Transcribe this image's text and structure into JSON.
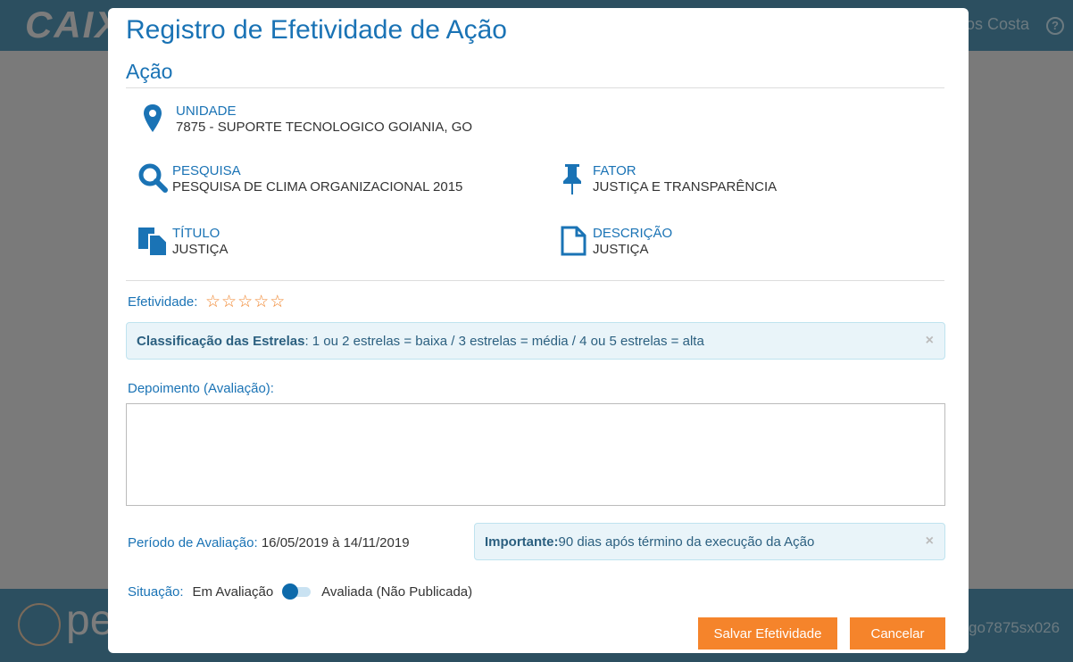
{
  "header": {
    "logo": "CAIXA",
    "user": "os Costa",
    "help": "?"
  },
  "footer": {
    "logo_text": "pe",
    "host": "go7875sx026"
  },
  "modal": {
    "title": "Registro de Efetividade de Ação",
    "section": "Ação",
    "fields": {
      "unidade": {
        "label": "UNIDADE",
        "value": "7875 - SUPORTE TECNOLOGICO GOIANIA, GO"
      },
      "pesquisa": {
        "label": "PESQUISA",
        "value": "PESQUISA DE CLIMA ORGANIZACIONAL 2015"
      },
      "fator": {
        "label": "FATOR",
        "value": "JUSTIÇA E TRANSPARÊNCIA"
      },
      "titulo": {
        "label": "TÍTULO",
        "value": "JUSTIÇA"
      },
      "descricao": {
        "label": "DESCRIÇÃO",
        "value": "JUSTIÇA"
      }
    },
    "efetividade": {
      "label": "Efetividade:",
      "rating": 0,
      "max": 5,
      "star": "☆"
    },
    "alert1": {
      "bold": "Classificação das Estrelas",
      "text": ": 1 ou 2 estrelas = baixa / 3 estrelas = média / 4 ou 5 estrelas = alta",
      "close": "×"
    },
    "depoimento": {
      "label": "Depoimento (Avaliação):",
      "value": "",
      "placeholder": ""
    },
    "periodo": {
      "label": "Período de Avaliação:",
      "value": "16/05/2019 à 14/11/2019"
    },
    "alert2": {
      "bold": "Importante:",
      "text": " 90 dias após término da execução da Ação",
      "close": "×"
    },
    "situacao": {
      "label": "Situação:",
      "off": "Em Avaliação",
      "on": "Avaliada (Não Publicada)",
      "checked": false
    },
    "buttons": {
      "save": "Salvar Efetividade",
      "cancel": "Cancelar"
    }
  }
}
